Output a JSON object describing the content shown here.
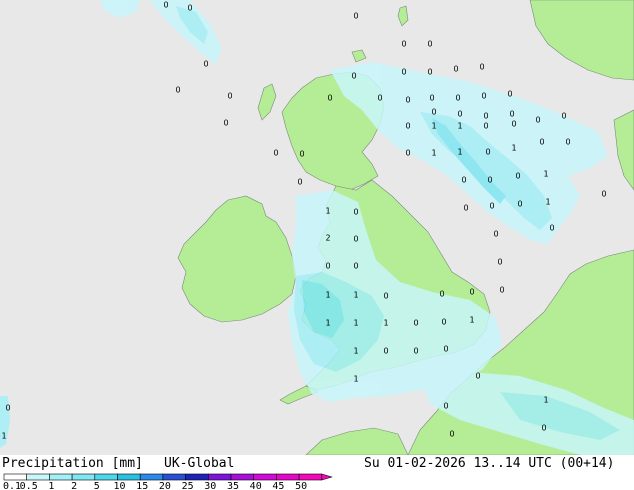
{
  "title_left": "Precipitation [mm]",
  "model": "UK-Global",
  "valid_time": "Su 01-02-2026 13..14 UTC (00+14)",
  "legend": {
    "labels": [
      "0.1",
      "0.5",
      "1",
      "2",
      "5",
      "10",
      "15",
      "20",
      "25",
      "30",
      "35",
      "40",
      "45",
      "50"
    ],
    "colors": [
      "#ffffff",
      "#c8f6fa",
      "#a3eff7",
      "#7fe6f2",
      "#4fd6ea",
      "#2cc0e0",
      "#2a88e8",
      "#2a4fd0",
      "#1e23b8",
      "#7b16d8",
      "#a810d8",
      "#d00cd8",
      "#e608c8",
      "#f20ab8"
    ]
  },
  "map_colors": {
    "sea": "#e8e8e8",
    "land": "#b4ed96",
    "precip_light": "#c8f6fa",
    "precip_moderate": "#a3eff7",
    "precip_heavy": "#7fe6f2"
  },
  "markers": {
    "zero": "0",
    "one": "1",
    "two": "2"
  }
}
